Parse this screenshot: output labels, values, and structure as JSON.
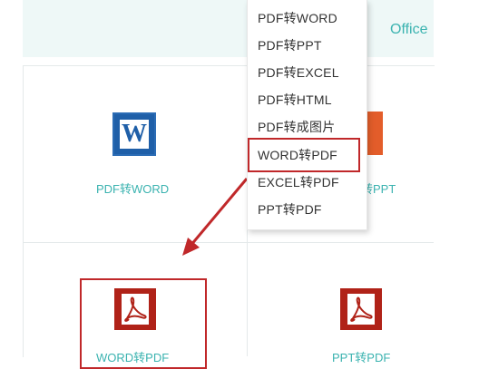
{
  "header": {
    "office_link": "Office"
  },
  "tools": {
    "pdf_to_word": {
      "label": "PDF转WORD",
      "icon": "word-icon"
    },
    "pdf_to_ppt": {
      "label": "转PPT",
      "icon": "ppt-icon"
    },
    "word_to_pdf": {
      "label": "WORD转PDF",
      "icon": "pdf-icon"
    },
    "ppt_to_pdf": {
      "label": "PPT转PDF",
      "icon": "pdf-icon"
    }
  },
  "dropdown": {
    "items": [
      {
        "label": "PDF转WORD"
      },
      {
        "label": "PDF转PPT"
      },
      {
        "label": "PDF转EXCEL"
      },
      {
        "label": "PDF转HTML"
      },
      {
        "label": "PDF转成图片"
      },
      {
        "label": "WORD转PDF"
      },
      {
        "label": "EXCEL转PDF"
      },
      {
        "label": "PPT转PDF"
      }
    ],
    "highlighted_item": "WORD转PDF"
  },
  "colors": {
    "accent": "#3bb3b0",
    "highlight_red": "#c0282a",
    "word_blue": "#1f5fa8",
    "pdf_red": "#b02218",
    "ppt_orange": "#e35d2a"
  }
}
